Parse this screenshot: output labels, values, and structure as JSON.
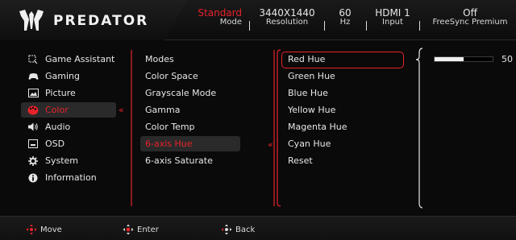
{
  "brand": {
    "name": "PREDATOR",
    "logo_icon": "predator-logo-icon"
  },
  "status": [
    {
      "value": "Standard",
      "key": "Mode",
      "highlight": true
    },
    {
      "value": "3440X1440",
      "key": "Resolution",
      "highlight": false
    },
    {
      "value": "60",
      "key": "Hz",
      "highlight": false
    },
    {
      "value": "HDMI 1",
      "key": "Input",
      "highlight": false
    },
    {
      "value": "Off",
      "key": "FreeSync Premium",
      "highlight": false
    }
  ],
  "nav": {
    "items": [
      {
        "label": "Game Assistant",
        "icon": "game-assistant-icon"
      },
      {
        "label": "Gaming",
        "icon": "gamepad-icon"
      },
      {
        "label": "Picture",
        "icon": "picture-icon"
      },
      {
        "label": "Color",
        "icon": "palette-icon",
        "active": true
      },
      {
        "label": "Audio",
        "icon": "speaker-icon"
      },
      {
        "label": "OSD",
        "icon": "osd-icon"
      },
      {
        "label": "System",
        "icon": "gear-icon"
      },
      {
        "label": "Information",
        "icon": "info-icon"
      }
    ],
    "active_arrow": "«"
  },
  "submenu": {
    "items": [
      "Modes",
      "Color Space",
      "Grayscale Mode",
      "Gamma",
      "Color Temp",
      "6-axis Hue",
      "6-axis Saturate"
    ],
    "active_index": 5,
    "active_arrow": "«"
  },
  "options": {
    "items": [
      "Red Hue",
      "Green Hue",
      "Blue Hue",
      "Yellow Hue",
      "Magenta Hue",
      "Cyan Hue",
      "Reset"
    ],
    "selected_index": 0
  },
  "slider": {
    "value": "50",
    "fraction": 0.5
  },
  "footer": {
    "hints": [
      {
        "label": "Move",
        "icon": "joystick-move-icon"
      },
      {
        "label": "Enter",
        "icon": "joystick-enter-icon"
      },
      {
        "label": "Back",
        "icon": "joystick-back-icon"
      }
    ]
  },
  "colors": {
    "accent": "#e8232b",
    "bracket": "#e8232b",
    "slider_bracket": "#e6e6e6"
  }
}
